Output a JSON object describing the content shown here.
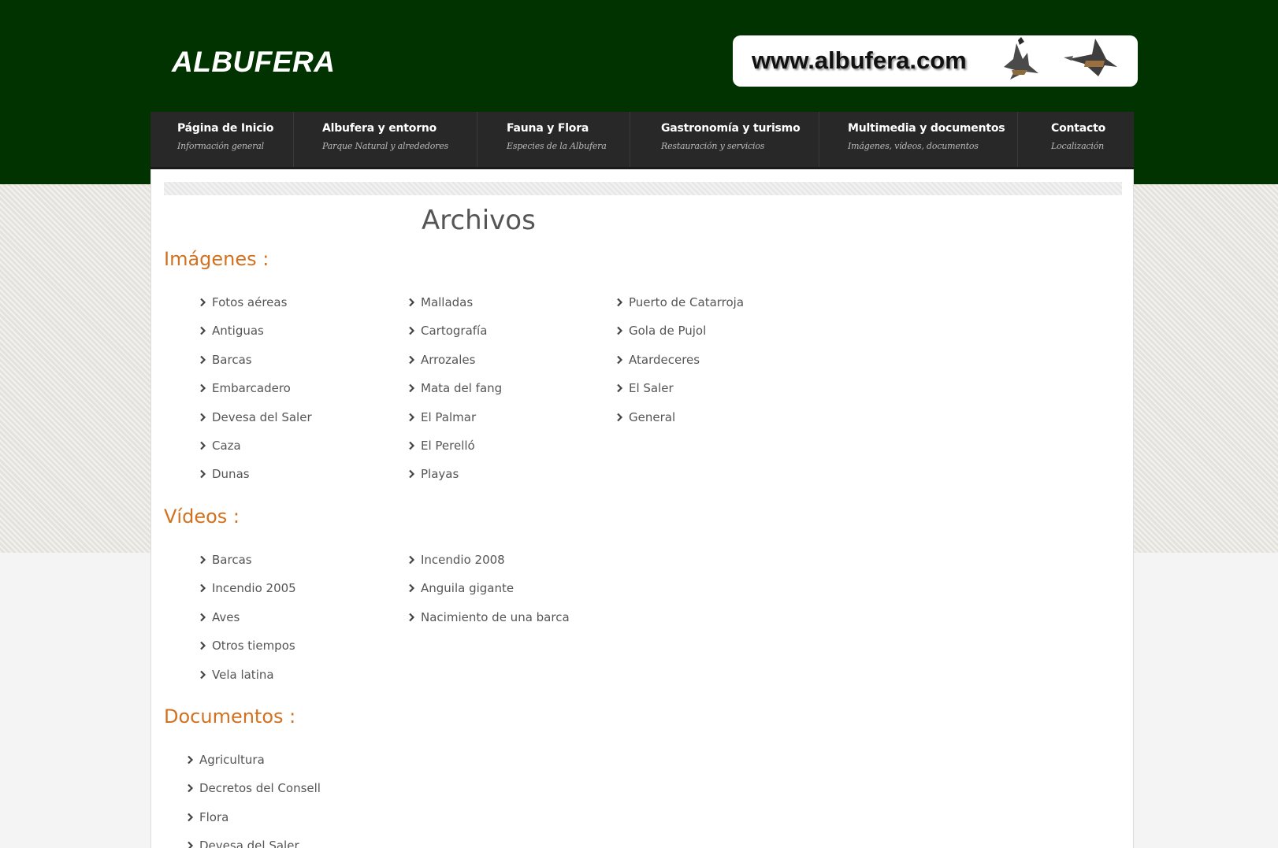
{
  "header": {
    "logo_text": "ALBUFERA",
    "banner_text": "www.albufera.com"
  },
  "nav": [
    {
      "title": "Página de Inicio",
      "subtitle": "Información general"
    },
    {
      "title": "Albufera y entorno",
      "subtitle": "Parque Natural y alrededores"
    },
    {
      "title": "Fauna y Flora",
      "subtitle": "Especies de la Albufera"
    },
    {
      "title": "Gastronomía y turismo",
      "subtitle": "Restauración y servicios"
    },
    {
      "title": "Multimedia y documentos",
      "subtitle": "Imágenes, vídeos, documentos"
    },
    {
      "title": "Contacto",
      "subtitle": "Localización"
    }
  ],
  "page_title": "Archivos",
  "sections": {
    "imagenes": {
      "title": "Imágenes :",
      "col1": [
        "Fotos aéreas",
        "Antiguas",
        "Barcas",
        "Embarcadero",
        "Devesa del Saler",
        "Caza",
        "Dunas"
      ],
      "col2": [
        "Malladas",
        "Cartografía",
        "Arrozales",
        "Mata del fang",
        "El Palmar",
        "El Perelló",
        "Playas"
      ],
      "col3": [
        "Puerto de Catarroja",
        "Gola de Pujol",
        "Atardeceres",
        "El Saler",
        "General"
      ]
    },
    "videos": {
      "title": "Vídeos :",
      "col1": [
        "Barcas",
        "Incendio 2005",
        "Aves",
        "Otros tiempos",
        "Vela latina"
      ],
      "col2": [
        "Incendio 2008",
        "Anguila gigante",
        "Nacimiento de una barca"
      ]
    },
    "documentos": {
      "title": "Documentos :",
      "col1": [
        "Agricultura",
        "Decretos del Consell",
        "Flora",
        "Devesa del Saler"
      ]
    }
  },
  "colors": {
    "header_bg": "#003300",
    "nav_bg": "#282828",
    "section_title": "#d2711f",
    "text": "#555555"
  }
}
